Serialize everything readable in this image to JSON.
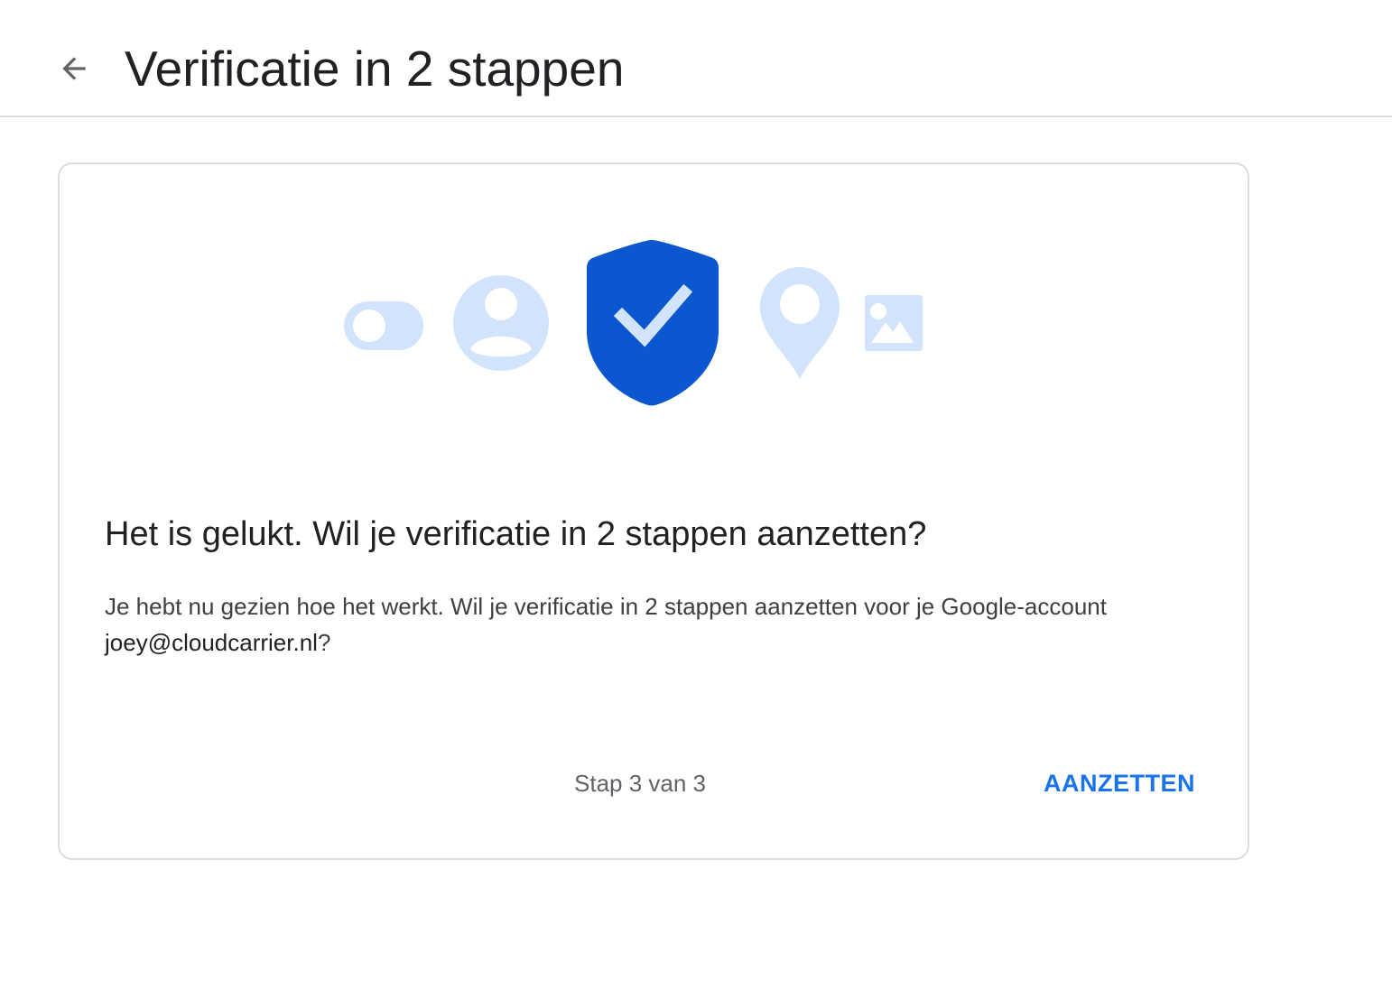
{
  "header": {
    "back_icon": "arrow-back-icon",
    "title": "Verificatie in 2 stappen"
  },
  "illustration": {
    "icons": [
      "toggle-icon",
      "account-circle-icon",
      "shield-check-icon",
      "location-pin-icon",
      "image-icon"
    ],
    "colors": {
      "light_blue": "#d2e3fc",
      "shield_blue": "#0b57d0"
    }
  },
  "card": {
    "heading": "Het is gelukt. Wil je verificatie in 2 stappen aanzetten?",
    "body_prefix": "Je hebt nu gezien hoe het werkt. Wil je verificatie in 2 stappen aanzetten voor je Google-account",
    "email": "joey@cloudcarrier.nl",
    "body_suffix": "?",
    "step_text": "Stap 3 van 3",
    "enable_button": "AANZETTEN"
  },
  "colors": {
    "accent": "#1a73e8",
    "border": "#dadce0"
  }
}
